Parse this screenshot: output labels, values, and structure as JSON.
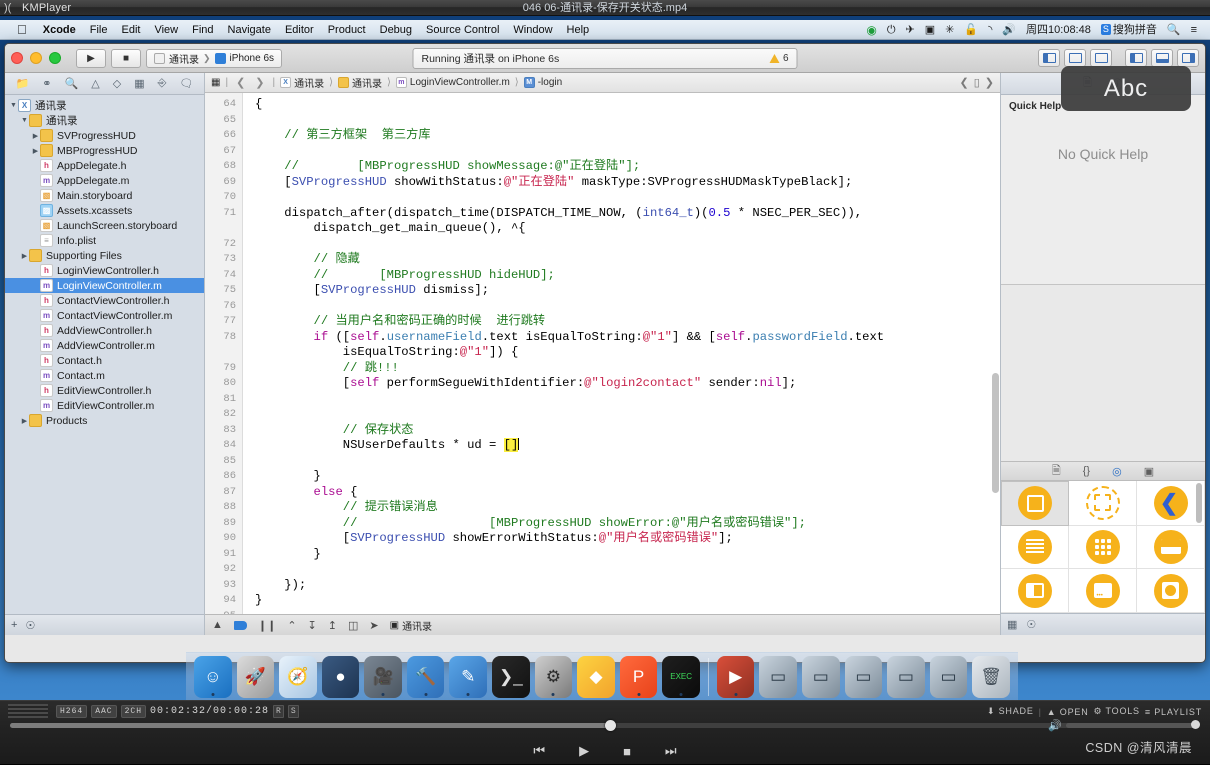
{
  "player": {
    "app_name": "KMPlayer",
    "logo_icon": "kmplayer-logo-icon",
    "window_title": "046 06-通讯录-保存开关状态.mp4",
    "codecs": [
      "H264",
      "AAC",
      "2CH"
    ],
    "time": "00:02:32/00:00:28",
    "flags": [
      "R",
      "S"
    ],
    "right_controls": [
      {
        "icon": "shade-icon",
        "label": "SHADE"
      },
      {
        "icon": "eject-icon",
        "label": "OPEN"
      },
      {
        "icon": "gear-icon",
        "label": "TOOLS"
      },
      {
        "icon": "list-icon",
        "label": "PLAYLIST"
      }
    ],
    "transport": [
      {
        "icon": "previous-icon",
        "glyph": "⏮"
      },
      {
        "icon": "play-icon",
        "glyph": "▶"
      },
      {
        "icon": "stop-icon",
        "glyph": "■"
      },
      {
        "icon": "next-icon",
        "glyph": "⏭"
      }
    ],
    "speaker_icon": "speaker-icon",
    "watermark": "CSDN @清风清晨",
    "seek_percent": 50.4,
    "volume_percent": 100
  },
  "macmenu": {
    "apple": "",
    "items": [
      "Xcode",
      "File",
      "Edit",
      "View",
      "Find",
      "Navigate",
      "Editor",
      "Product",
      "Debug",
      "Source Control",
      "Window",
      "Help"
    ],
    "status_items": [
      {
        "name": "recording-indicator-icon",
        "glyph": "◉"
      },
      {
        "name": "power-icon",
        "glyph": "⏻"
      },
      {
        "name": "airplane-icon",
        "glyph": "✈"
      },
      {
        "name": "screen-record-icon",
        "glyph": "▣"
      },
      {
        "name": "bluetooth-icon",
        "glyph": "✳"
      },
      {
        "name": "lock-icon",
        "glyph": "🔓"
      },
      {
        "name": "wifi-icon",
        "glyph": "◝"
      },
      {
        "name": "volume-icon",
        "glyph": "🔊"
      }
    ],
    "clock": "周四10:08:48",
    "input_method_badge": "S",
    "input_method": "搜狗拼音",
    "search_icon": "search-icon",
    "notification_icon": "notification-center-icon"
  },
  "xcode": {
    "toolbar": {
      "run_icon": "run-button-icon",
      "stop_icon": "stop-button-icon",
      "scheme_project": "通讯录",
      "scheme_device": "iPhone 6s",
      "activity_text": "Running 通讯录 on iPhone 6s",
      "warning_count": "6",
      "editor_modes": [
        "standard-editor-icon",
        "assistant-editor-icon",
        "version-editor-icon"
      ],
      "view_toggles": [
        "navigator-toggle-icon",
        "debug-area-toggle-icon",
        "utilities-toggle-icon"
      ]
    },
    "abc_tooltip": "Abc",
    "navigator": {
      "tabs": [
        "project-navigator-icon",
        "source-control-navigator-icon",
        "find-navigator-icon",
        "issue-navigator-icon",
        "test-navigator-icon",
        "debug-navigator-icon",
        "breakpoint-navigator-icon",
        "report-navigator-icon"
      ],
      "tree": [
        {
          "label": "通讯录",
          "indent": 0,
          "arrow": "▼",
          "icon": "proj",
          "glyph": "X",
          "selected": false
        },
        {
          "label": "通讯录",
          "indent": 1,
          "arrow": "▼",
          "icon": "folder",
          "glyph": "",
          "selected": false
        },
        {
          "label": "SVProgressHUD",
          "indent": 2,
          "arrow": "▶",
          "icon": "folder",
          "glyph": "",
          "selected": false
        },
        {
          "label": "MBProgressHUD",
          "indent": 2,
          "arrow": "▶",
          "icon": "folder",
          "glyph": "",
          "selected": false
        },
        {
          "label": "AppDelegate.h",
          "indent": 2,
          "arrow": "",
          "icon": "h",
          "glyph": "h",
          "selected": false
        },
        {
          "label": "AppDelegate.m",
          "indent": 2,
          "arrow": "",
          "icon": "m",
          "glyph": "m",
          "selected": false
        },
        {
          "label": "Main.storyboard",
          "indent": 2,
          "arrow": "",
          "icon": "sb",
          "glyph": "▧",
          "selected": false
        },
        {
          "label": "Assets.xcassets",
          "indent": 2,
          "arrow": "",
          "icon": "xc",
          "glyph": "▨",
          "selected": false
        },
        {
          "label": "LaunchScreen.storyboard",
          "indent": 2,
          "arrow": "",
          "icon": "sb",
          "glyph": "▧",
          "selected": false
        },
        {
          "label": "Info.plist",
          "indent": 2,
          "arrow": "",
          "icon": "pl",
          "glyph": "≡",
          "selected": false
        },
        {
          "label": "Supporting Files",
          "indent": 1,
          "arrow": "▶",
          "icon": "folder",
          "glyph": "",
          "selected": false
        },
        {
          "label": "LoginViewController.h",
          "indent": 2,
          "arrow": "",
          "icon": "h",
          "glyph": "h",
          "selected": false
        },
        {
          "label": "LoginViewController.m",
          "indent": 2,
          "arrow": "",
          "icon": "m",
          "glyph": "m",
          "selected": true
        },
        {
          "label": "ContactViewController.h",
          "indent": 2,
          "arrow": "",
          "icon": "h",
          "glyph": "h",
          "selected": false
        },
        {
          "label": "ContactViewController.m",
          "indent": 2,
          "arrow": "",
          "icon": "m",
          "glyph": "m",
          "selected": false
        },
        {
          "label": "AddViewController.h",
          "indent": 2,
          "arrow": "",
          "icon": "h",
          "glyph": "h",
          "selected": false
        },
        {
          "label": "AddViewController.m",
          "indent": 2,
          "arrow": "",
          "icon": "m",
          "glyph": "m",
          "selected": false
        },
        {
          "label": "Contact.h",
          "indent": 2,
          "arrow": "",
          "icon": "h",
          "glyph": "h",
          "selected": false
        },
        {
          "label": "Contact.m",
          "indent": 2,
          "arrow": "",
          "icon": "m",
          "glyph": "m",
          "selected": false
        },
        {
          "label": "EditViewController.h",
          "indent": 2,
          "arrow": "",
          "icon": "h",
          "glyph": "h",
          "selected": false
        },
        {
          "label": "EditViewController.m",
          "indent": 2,
          "arrow": "",
          "icon": "m",
          "glyph": "m",
          "selected": false
        },
        {
          "label": "Products",
          "indent": 1,
          "arrow": "▶",
          "icon": "folder",
          "glyph": "",
          "selected": false
        }
      ],
      "footer": {
        "add_icon": "add-button-icon",
        "filter_icon": "filter-icon"
      }
    },
    "jumpbar": {
      "related_icon": "related-items-icon",
      "back_icon": "back-arrow-icon",
      "forward_icon": "forward-arrow-icon",
      "breadcrumbs": [
        "通讯录",
        "通讯录",
        "LoginViewController.m",
        "-login"
      ],
      "right_icons": [
        "previous-counterpart-icon",
        "hide-utilities-icon",
        "next-counterpart-icon"
      ]
    },
    "editor": {
      "first_line_number": 64,
      "lines": [
        {
          "n": "64",
          "h": "<span class=\"b\">{</span>"
        },
        {
          "n": "65",
          "h": ""
        },
        {
          "n": "66",
          "h": "    <span class=\"cmt\">// 第三方框架  第三方库</span>"
        },
        {
          "n": "67",
          "h": ""
        },
        {
          "n": "68",
          "h": "    <span class=\"cmt\">//        [MBProgressHUD showMessage:@\"正在登陆\"];</span>"
        },
        {
          "n": "69",
          "h": "    [<span class=\"cls\">SVProgressHUD</span> showWithStatus:<span class=\"str\">@\"正在登陆\"</span> maskType:SVProgressHUDMaskTypeBlack];"
        },
        {
          "n": "70",
          "h": ""
        },
        {
          "n": "71",
          "h": "    dispatch_after(dispatch_time(DISPATCH_TIME_NOW, (<span class=\"cls\">int64_t</span>)(<span class=\"num\">0.5</span> * NSEC_PER_SEC)),"
        },
        {
          "n": "",
          "h": "        dispatch_get_main_queue(), ^{"
        },
        {
          "n": "72",
          "h": ""
        },
        {
          "n": "73",
          "h": "        <span class=\"cmt\">// 隐藏</span>"
        },
        {
          "n": "74",
          "h": "        <span class=\"cmt\">//       [MBProgressHUD hideHUD];</span>"
        },
        {
          "n": "75",
          "h": "        [<span class=\"cls\">SVProgressHUD</span> dismiss];"
        },
        {
          "n": "76",
          "h": ""
        },
        {
          "n": "77",
          "h": "        <span class=\"cmt\">// 当用户名和密码正确的时候  进行跳转</span>"
        },
        {
          "n": "78",
          "h": "        <span class=\"kw\">if</span> ([<span class=\"kw\">self</span>.<span class=\"prop\">usernameField</span>.text isEqualToString:<span class=\"str\">@\"1\"</span>] &amp;&amp; [<span class=\"kw\">self</span>.<span class=\"prop\">passwordField</span>.text"
        },
        {
          "n": "",
          "h": "            isEqualToString:<span class=\"str\">@\"1\"</span>]) {"
        },
        {
          "n": "79",
          "h": "            <span class=\"cmt\">// 跳!!!</span>"
        },
        {
          "n": "80",
          "h": "            [<span class=\"kw\">self</span> performSegueWithIdentifier:<span class=\"str\">@\"login2contact\"</span> sender:<span class=\"kw\">nil</span>];"
        },
        {
          "n": "81",
          "h": ""
        },
        {
          "n": "82",
          "h": ""
        },
        {
          "n": "83",
          "h": "            <span class=\"cmt\">// 保存状态</span>"
        },
        {
          "n": "84",
          "h": "            NSUserDefaults * ud = <span class=\"hl\">[]</span><span class=\"caret\"></span>"
        },
        {
          "n": "85",
          "h": ""
        },
        {
          "n": "86",
          "h": "        }"
        },
        {
          "n": "87",
          "h": "        <span class=\"kw\">else</span> {"
        },
        {
          "n": "88",
          "h": "            <span class=\"cmt\">// 提示错误消息</span>"
        },
        {
          "n": "89",
          "h": "            <span class=\"cmt\">//                  [MBProgressHUD showError:@\"用户名或密码错误\"];</span>"
        },
        {
          "n": "90",
          "h": "            [<span class=\"cls\">SVProgressHUD</span> showErrorWithStatus:<span class=\"str\">@\"用户名或密码错误\"</span>];"
        },
        {
          "n": "91",
          "h": "        }"
        },
        {
          "n": "92",
          "h": ""
        },
        {
          "n": "93",
          "h": "    });"
        },
        {
          "n": "94",
          "h": "}"
        },
        {
          "n": "95",
          "h": ""
        }
      ],
      "footer_scheme": "通讯录"
    },
    "utilities": {
      "tabs": [
        "file-inspector-icon",
        "quick-help-inspector-icon"
      ],
      "quick_help_title": "Quick Help",
      "quick_help_empty": "No Quick Help",
      "library_tabs": [
        "file-template-library-icon",
        "code-snippet-library-icon",
        "object-library-icon",
        "media-library-icon"
      ],
      "library_items": [
        {
          "name": "view-object",
          "kind": "sq",
          "selected": true
        },
        {
          "name": "placeholder-object",
          "kind": "dash",
          "selected": false
        },
        {
          "name": "back-navigation-object",
          "kind": "chev",
          "selected": false
        },
        {
          "name": "table-view-object",
          "kind": "lines",
          "selected": false
        },
        {
          "name": "collection-view-object",
          "kind": "dots9",
          "selected": false
        },
        {
          "name": "search-bar-object",
          "kind": "bar",
          "selected": false
        },
        {
          "name": "split-view-object",
          "kind": "split",
          "selected": false
        },
        {
          "name": "page-control-object",
          "kind": "card",
          "selected": false
        },
        {
          "name": "image-view-object",
          "kind": "smiley",
          "selected": false
        }
      ],
      "footer_icons": [
        "grid-view-icon",
        "filter-icon"
      ]
    }
  },
  "dock": {
    "items": [
      {
        "name": "finder",
        "glyph": "☺",
        "bg": "linear-gradient(135deg,#4aa3e8,#1a6fc0)",
        "color": "#fff",
        "running": true
      },
      {
        "name": "launchpad",
        "glyph": "🚀",
        "bg": "linear-gradient(135deg,#dcdcdc,#9a9a9a)",
        "color": "#444",
        "running": false
      },
      {
        "name": "safari",
        "glyph": "🧭",
        "bg": "linear-gradient(135deg,#e8f2fb,#a8c6e2)",
        "color": "#2b6fb5",
        "running": false
      },
      {
        "name": "mouse-app",
        "glyph": "●",
        "bg": "linear-gradient(135deg,#3a5a82,#1d3350)",
        "color": "#fff",
        "running": false
      },
      {
        "name": "quicktime",
        "glyph": "🎥",
        "bg": "linear-gradient(135deg,#7b8794,#4a5560)",
        "color": "#fff",
        "running": true
      },
      {
        "name": "xcode",
        "glyph": "🔨",
        "bg": "linear-gradient(135deg,#4c9ae0,#2f6fb8)",
        "color": "#fff",
        "running": true
      },
      {
        "name": "xcode-beta",
        "glyph": "✎",
        "bg": "linear-gradient(135deg,#5aa6e8,#2f6fb8)",
        "color": "#fff",
        "running": true
      },
      {
        "name": "terminal",
        "glyph": "❯_",
        "bg": "linear-gradient(135deg,#2a2a2a,#111)",
        "color": "#e0e0e0",
        "running": false
      },
      {
        "name": "system-preferences",
        "glyph": "⚙",
        "bg": "linear-gradient(135deg,#cfcfcf,#7a7a7a)",
        "color": "#2b2b2b",
        "running": true
      },
      {
        "name": "sketch",
        "glyph": "◆",
        "bg": "linear-gradient(135deg,#fdd341,#f2a32c)",
        "color": "#fff",
        "running": false
      },
      {
        "name": "paragon",
        "glyph": "P",
        "bg": "linear-gradient(135deg,#ff6a3d,#e8421a)",
        "color": "#fff",
        "running": true
      },
      {
        "name": "exec-app",
        "glyph": "EXEC",
        "bg": "linear-gradient(135deg,#1f1f1f,#0b0b0b)",
        "color": "#3ddc5a",
        "running": true
      },
      {
        "name": "separator",
        "glyph": "",
        "bg": "",
        "color": "",
        "running": false
      },
      {
        "name": "kmplayer",
        "glyph": "▶",
        "bg": "linear-gradient(135deg,#d94f3a,#8e2f22)",
        "color": "#fff",
        "running": true
      },
      {
        "name": "window-1",
        "glyph": "▭",
        "bg": "linear-gradient(135deg,#c9d4de,#7d8c99)",
        "color": "#2b3a47",
        "running": false
      },
      {
        "name": "window-2",
        "glyph": "▭",
        "bg": "linear-gradient(135deg,#c9d4de,#7d8c99)",
        "color": "#2b3a47",
        "running": false
      },
      {
        "name": "window-3",
        "glyph": "▭",
        "bg": "linear-gradient(135deg,#c9d4de,#7d8c99)",
        "color": "#2b3a47",
        "running": false
      },
      {
        "name": "window-4",
        "glyph": "▭",
        "bg": "linear-gradient(135deg,#c9d4de,#7d8c99)",
        "color": "#2b3a47",
        "running": false
      },
      {
        "name": "window-5",
        "glyph": "▭",
        "bg": "linear-gradient(135deg,#c9d4de,#7d8c99)",
        "color": "#2b3a47",
        "running": false
      },
      {
        "name": "trash",
        "glyph": "🗑",
        "bg": "linear-gradient(135deg,#e6eaee,#aab4bd)",
        "color": "#45505a",
        "running": false
      }
    ]
  }
}
